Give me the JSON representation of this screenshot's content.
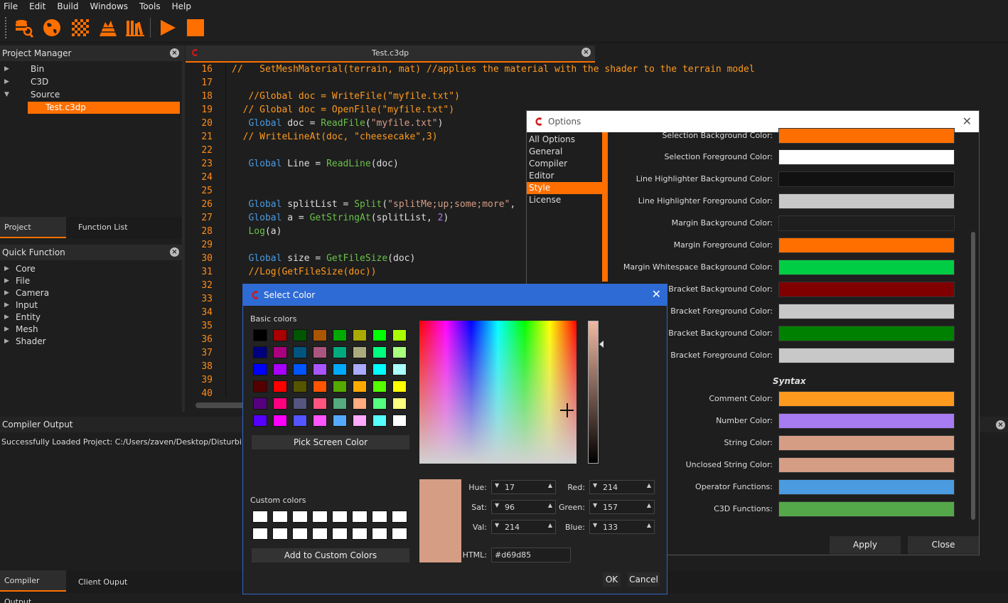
{
  "menu": [
    "File",
    "Edit",
    "Build",
    "Windows",
    "Tools",
    "Help"
  ],
  "toolbar": {
    "icons": [
      "database-search-icon",
      "globe-icon",
      "checker-texture-icon",
      "terrain-icon",
      "library-icon",
      "play-icon",
      "stop-icon"
    ]
  },
  "project_manager": {
    "title": "Project Manager",
    "tree": [
      {
        "label": "Bin",
        "arrow": "▶"
      },
      {
        "label": "C3D",
        "arrow": "▶"
      },
      {
        "label": "Source",
        "arrow": "▼"
      },
      {
        "label": "Test.c3dp",
        "arrow": ""
      }
    ],
    "tabs": [
      "Project Manager",
      "Function List"
    ]
  },
  "quick_function": {
    "title": "Quick Function",
    "items": [
      "Core",
      "File",
      "Camera",
      "Input",
      "Entity",
      "Mesh",
      "Shader"
    ]
  },
  "editor": {
    "tab_label": "Test.c3dp",
    "line_numbers": [
      "16",
      "17",
      "18",
      "19",
      "20",
      "21",
      "22",
      "23",
      "24",
      "25",
      "26",
      "27",
      "28",
      "29",
      "30",
      "31",
      "32",
      "33",
      "34",
      "35",
      "36",
      "37",
      "38",
      "39",
      "40"
    ]
  },
  "compiler_output": {
    "title": "Compiler Output",
    "message": "Successfully Loaded Project: C:/Users/zaven/Desktop/DisturbingIDE/Di",
    "tabs": [
      "Compiler Output",
      "Client Ouput"
    ]
  },
  "options": {
    "title": "Options",
    "categories": [
      "All Options",
      "General",
      "Compiler",
      "Editor",
      "Style",
      "License"
    ],
    "selected_category": "Style",
    "rows": [
      {
        "label": "Selection Background Color:",
        "color": "#ff6f00"
      },
      {
        "label": "Selection Foreground Color:",
        "color": "#ffffff"
      },
      {
        "label": "Line Highlighter Background Color:",
        "color": "#111111"
      },
      {
        "label": "Line Highlighter Foreground Color:",
        "color": "#c8c8c8"
      },
      {
        "label": "Margin Background Color:",
        "color": "#1e1e1e"
      },
      {
        "label": "Margin Foreground Color:",
        "color": "#ff6f00"
      },
      {
        "label": "Margin Whitespace Background Color:",
        "color": "#00cc44"
      },
      {
        "label": "hed Bracket Background Color:",
        "color": "#800000"
      },
      {
        "label": "hed Bracket Foreground Color:",
        "color": "#c8c8c8"
      },
      {
        "label": "hed Bracket Background Color:",
        "color": "#008000"
      },
      {
        "label": "hed Bracket Foreground Color:",
        "color": "#c8c8c8"
      }
    ],
    "syntax_title": "Syntax",
    "syntax_rows": [
      {
        "label": "Comment Color:",
        "color": "#ff9a1f"
      },
      {
        "label": "Number Color:",
        "color": "#a77cf2"
      },
      {
        "label": "String Color:",
        "color": "#d69d85"
      },
      {
        "label": "Unclosed String Color:",
        "color": "#d69d85"
      },
      {
        "label": "Operator Functions:",
        "color": "#4a9be0"
      },
      {
        "label": "C3D Functions:",
        "color": "#55a84a"
      }
    ],
    "apply_label": "Apply",
    "close_label": "Close"
  },
  "select_color": {
    "title": "Select Color",
    "basic_colors_label": "Basic colors",
    "basic_colors": [
      "#000000",
      "#aa0000",
      "#005500",
      "#aa5500",
      "#00aa00",
      "#aaaa00",
      "#00ff00",
      "#aaff00",
      "#00007f",
      "#aa007f",
      "#00557f",
      "#aa557f",
      "#00aa7f",
      "#aaaa7f",
      "#00ff7f",
      "#aaff7f",
      "#0000ff",
      "#aa00ff",
      "#0055ff",
      "#aa55ff",
      "#00aaff",
      "#aaaaff",
      "#00ffff",
      "#aaffff",
      "#550000",
      "#ff0000",
      "#555500",
      "#ff5500",
      "#55aa00",
      "#ffaa00",
      "#55ff00",
      "#ffff00",
      "#55007f",
      "#ff007f",
      "#55557f",
      "#ff557f",
      "#55aa7f",
      "#ffaa7f",
      "#55ff7f",
      "#ffff7f",
      "#5500ff",
      "#ff00ff",
      "#5555ff",
      "#ff55ff",
      "#55aaff",
      "#ffaaff",
      "#55ffff",
      "#ffffff"
    ],
    "pick_screen_label": "Pick Screen Color",
    "custom_colors_label": "Custom colors",
    "add_custom_label": "Add to Custom Colors",
    "current_color": "#d69d85",
    "hue_label": "Hue:",
    "hue": "17",
    "sat_label": "Sat:",
    "sat": "96",
    "val_label": "Val:",
    "val": "214",
    "red_label": "Red:",
    "red": "214",
    "green_label": "Green:",
    "green": "157",
    "blue_label": "Blue:",
    "blue": "133",
    "html_label": "HTML:",
    "html": "#d69d85",
    "ok_label": "OK",
    "cancel_label": "Cancel"
  },
  "colors": {
    "accent": "#ff6f00",
    "dialog_blue": "#2f6bd5"
  }
}
